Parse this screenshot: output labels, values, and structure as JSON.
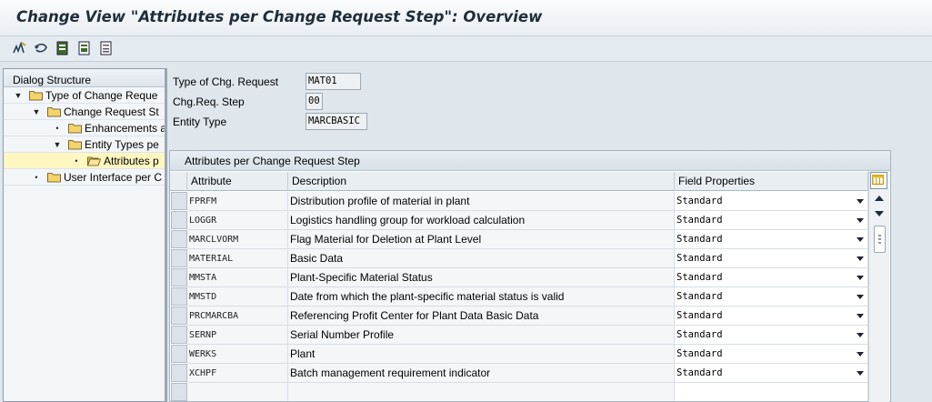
{
  "window": {
    "title": "Change View \"Attributes per Change Request Step\": Overview"
  },
  "toolbar": {
    "buttons": [
      {
        "icon": "display-change-icon"
      },
      {
        "icon": "undo-icon"
      },
      {
        "icon": "select-all-icon"
      },
      {
        "icon": "select-block-icon"
      },
      {
        "icon": "deselect-all-icon"
      }
    ]
  },
  "dialog_structure": {
    "header": "Dialog Structure",
    "items": [
      {
        "label": "Type of Change Reque",
        "marker": "▼",
        "level": 0,
        "selected": false
      },
      {
        "label": "Change Request St",
        "marker": "▼",
        "level": 1,
        "selected": false
      },
      {
        "label": "Enhancements a",
        "marker": "•",
        "level": 2,
        "selected": false
      },
      {
        "label": "Entity Types pe",
        "marker": "▼",
        "level": 2,
        "selected": false
      },
      {
        "label": "Attributes p",
        "marker": "•",
        "level": 3,
        "selected": true
      },
      {
        "label": "User Interface per C",
        "marker": "•",
        "level": 1,
        "selected": false
      }
    ]
  },
  "header_fields": {
    "type_of_chg_request": {
      "label": "Type of Chg. Request",
      "value": "MAT01"
    },
    "chg_req_step": {
      "label": "Chg.Req. Step",
      "value": "00"
    },
    "entity_type": {
      "label": "Entity Type",
      "value": "MARCBASIC"
    }
  },
  "table": {
    "title": "Attributes per Change Request Step",
    "columns": {
      "attribute": "Attribute",
      "description": "Description",
      "field_properties": "Field Properties"
    },
    "rows": [
      {
        "attribute": "FPRFM",
        "description": "Distribution profile of material in plant",
        "field_properties": "Standard"
      },
      {
        "attribute": "LOGGR",
        "description": "Logistics handling group for workload calculation",
        "field_properties": "Standard"
      },
      {
        "attribute": "MARCLVORM",
        "description": "Flag Material for Deletion at Plant Level",
        "field_properties": "Standard"
      },
      {
        "attribute": "MATERIAL",
        "description": "Basic Data",
        "field_properties": "Standard"
      },
      {
        "attribute": "MMSTA",
        "description": "Plant-Specific Material Status",
        "field_properties": "Standard"
      },
      {
        "attribute": "MMSTD",
        "description": "Date from which the plant-specific material status is valid",
        "field_properties": "Standard"
      },
      {
        "attribute": "PRCMARCBA",
        "description": "Referencing Profit Center for Plant Data Basic Data",
        "field_properties": "Standard"
      },
      {
        "attribute": "SERNP",
        "description": "Serial Number Profile",
        "field_properties": "Standard"
      },
      {
        "attribute": "WERKS",
        "description": "Plant",
        "field_properties": "Standard"
      },
      {
        "attribute": "XCHPF",
        "description": "Batch management requirement indicator",
        "field_properties": "Standard"
      },
      {
        "attribute": "",
        "description": "",
        "field_properties": ""
      }
    ]
  },
  "colors": {
    "selected_row": "#fff7c2",
    "folder": "#f5d36b",
    "accent": "#1f2d3a"
  }
}
